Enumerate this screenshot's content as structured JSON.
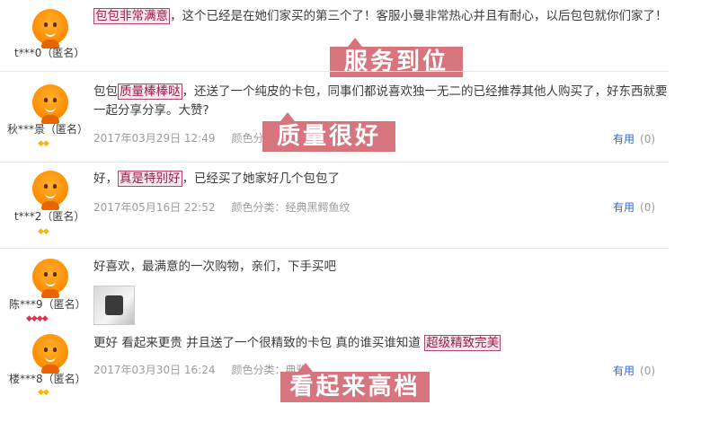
{
  "reviews": [
    {
      "user": "t***0（匿名）",
      "parts": {
        "pre": "",
        "hl": "包包非常满意",
        "post": "，这个已经是在她们家买的第三个了！客服小曼非常热心并且有耐心，以后包包就你们家了！"
      },
      "date": "",
      "cat": "",
      "useful": "",
      "count": ""
    },
    {
      "user": "秋***景（匿名）",
      "parts": {
        "pre": "包包",
        "hl": "质量棒棒哒",
        "post": "，还送了一个纯皮的卡包，同事们都说喜欢独一无二的已经推荐其他人购买了，好东西就要一起分享分享。大赞?"
      },
      "date": "2017年03月29日  12:49",
      "cat": "颜色分类",
      "useful": "有用",
      "count": "(0)"
    },
    {
      "user": "t***2（匿名）",
      "parts": {
        "pre": "好，",
        "hl": "真是特别好",
        "post": "，已经买了她家好几个包包了"
      },
      "date": "2017年05月16日  22:52",
      "cat": "颜色分类：经典黑鳄鱼纹",
      "useful": "有用",
      "count": "(0)"
    },
    {
      "user": "陈***9（匿名）",
      "parts": {
        "pre": "好喜欢，最满意的一次购物，亲们，下手买吧",
        "hl": "",
        "post": ""
      },
      "date": "",
      "cat": "",
      "useful": "",
      "count": ""
    },
    {
      "user": "楼***8（匿名）",
      "parts": {
        "pre": "更好 看起来更贵 并且送了一个很精致的卡包 真的谁买谁知道 ",
        "hl": "超级精致完美",
        "post": ""
      },
      "date": "2017年03月30日  16:24",
      "cat": "颜色分类：典雅",
      "useful": "有用",
      "count": "(0)"
    }
  ],
  "banners": [
    "服务到位",
    "质量很好",
    "看起来高档"
  ],
  "icons": {
    "avatar": "orange-mascot-avatar-icon",
    "gem": "diamond-level-icon"
  }
}
